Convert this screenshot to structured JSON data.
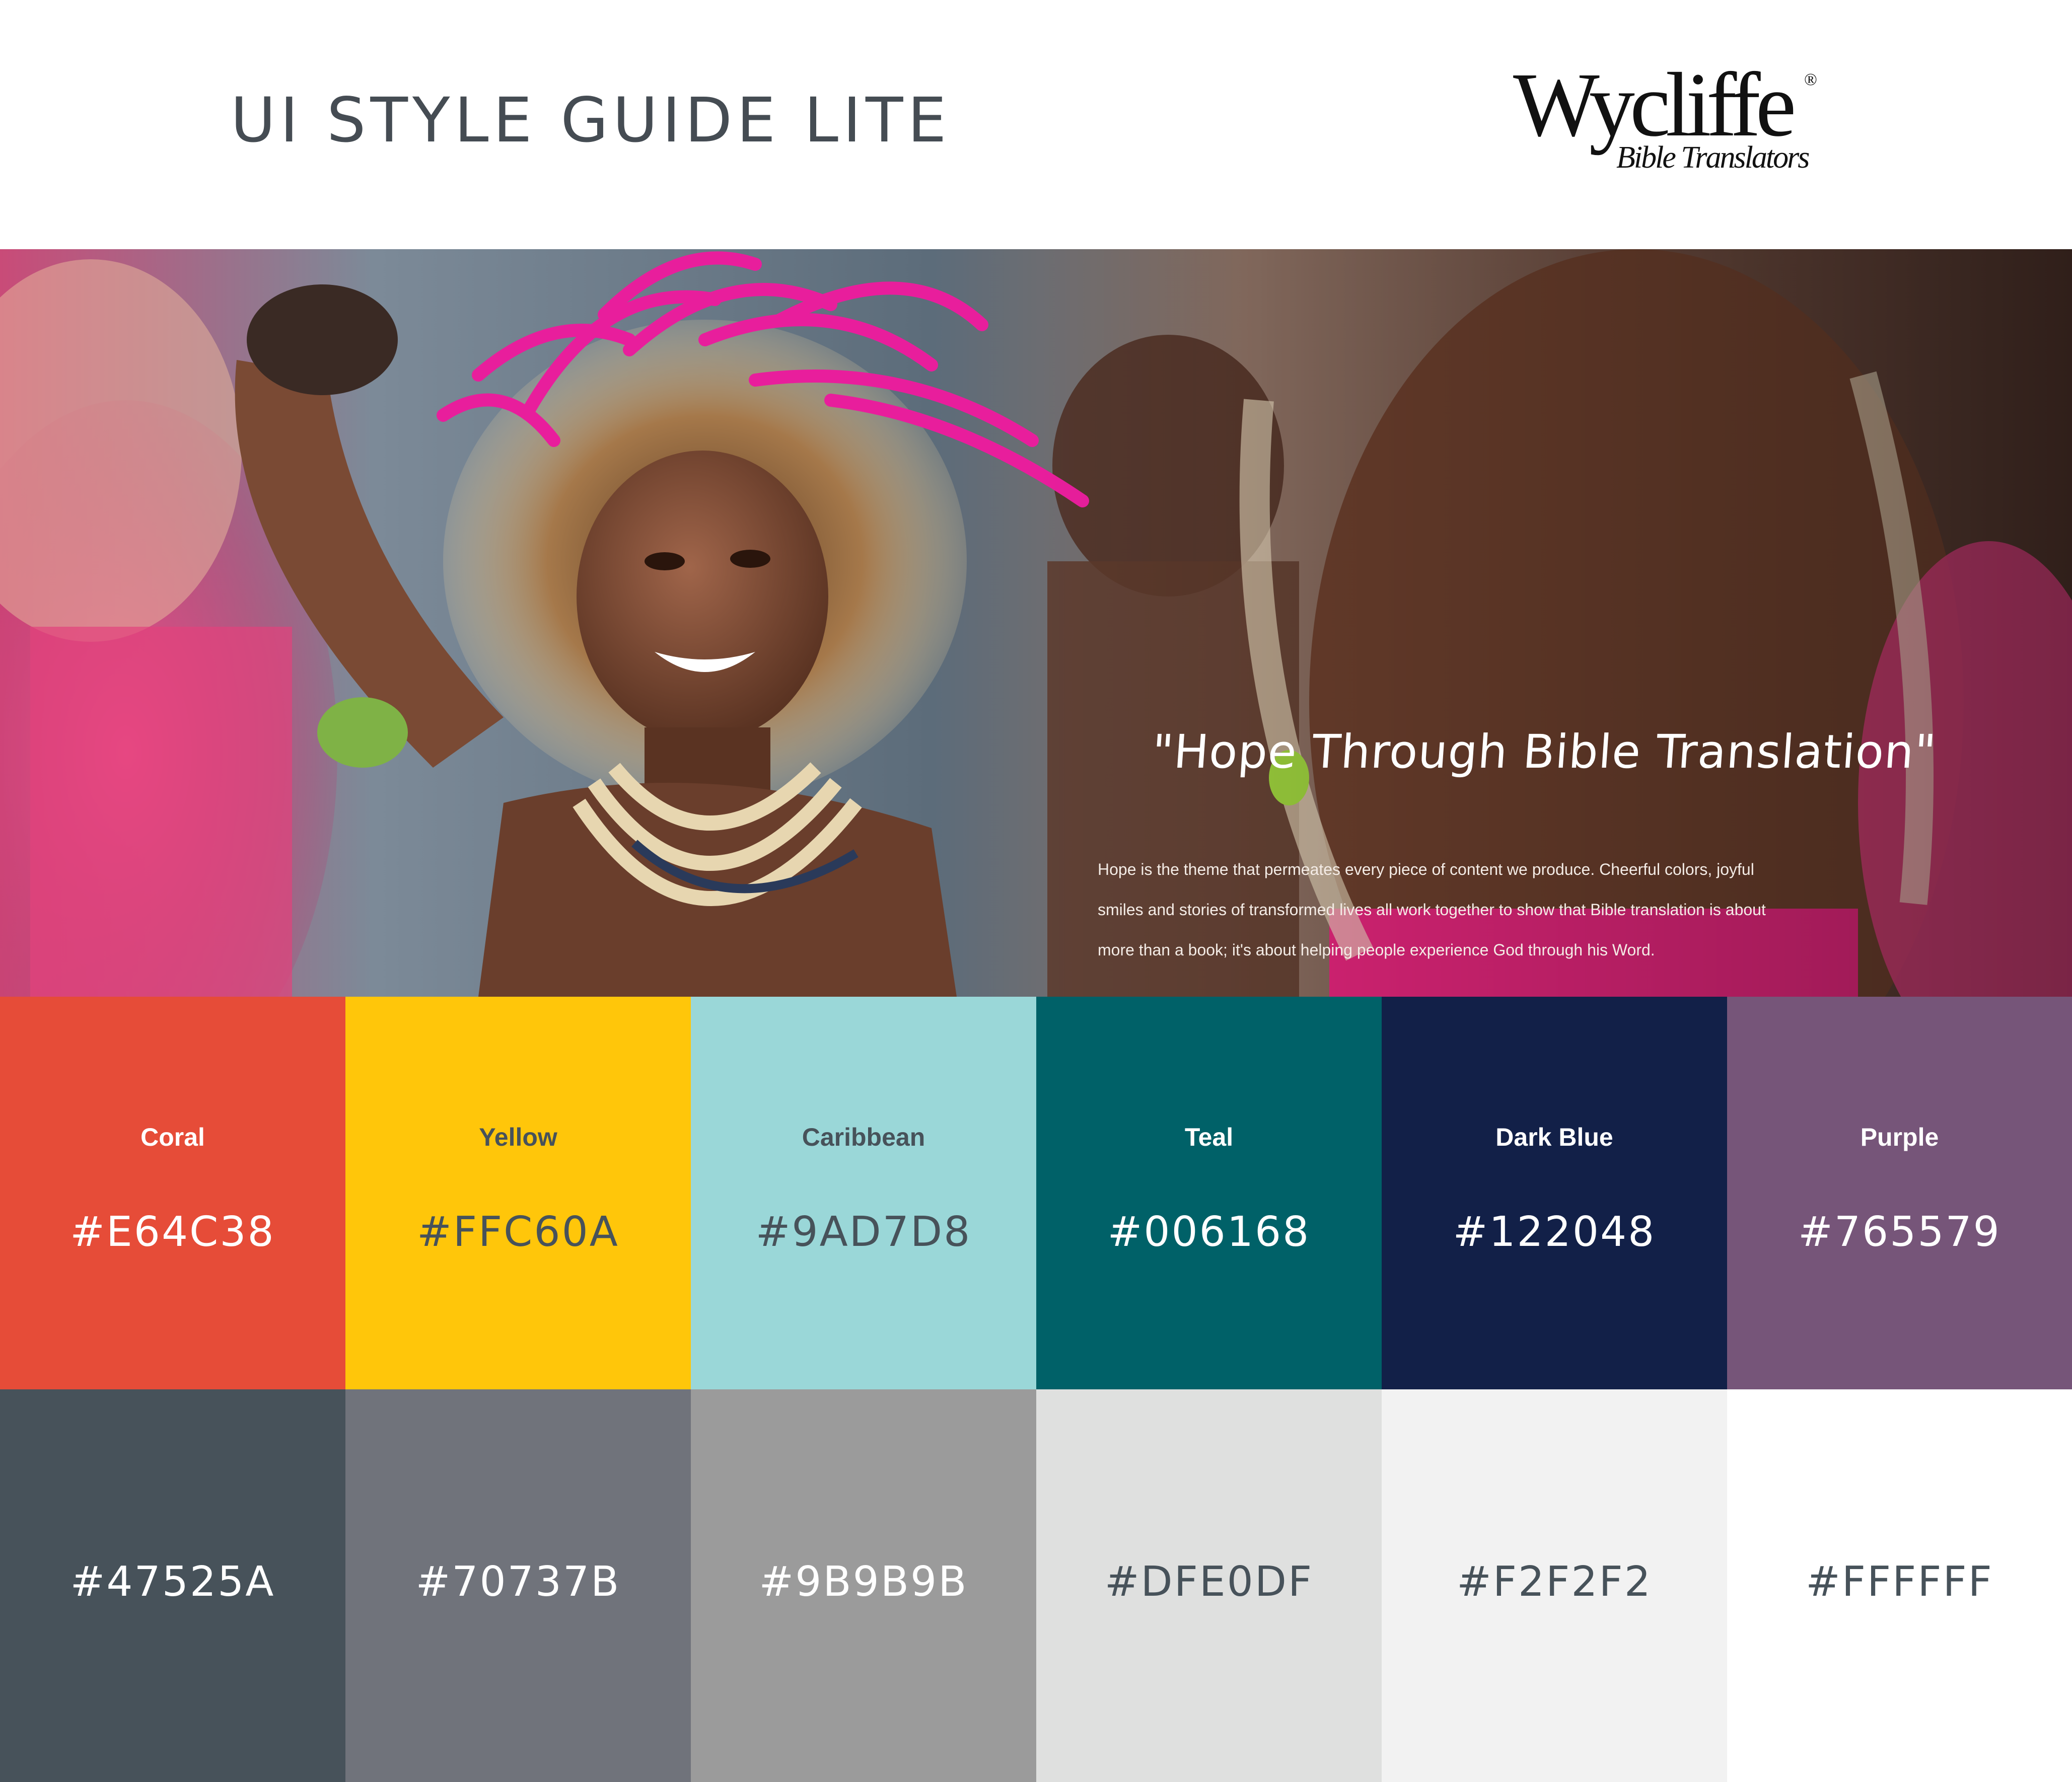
{
  "header": {
    "title": "UI STYLE GUIDE LITE",
    "logo_word": "Wycliffe",
    "logo_mark": "®",
    "logo_sub": "Bible Translators"
  },
  "hero": {
    "quote": "\"Hope Through Bible Translation\"",
    "body": "Hope is the theme that permeates every piece of content we produce. Cheerful colors, joyful smiles and stories of transformed lives all work together to show that Bible translation is about more than a book; it's about helping people experience God through his Word."
  },
  "palette": {
    "primary": [
      {
        "name": "Coral",
        "hex": "#E64C38",
        "bg": "#E64C38",
        "fg": "#ffffff"
      },
      {
        "name": "Yellow",
        "hex": "#FFC60A",
        "bg": "#FFC60A",
        "fg": "#47525A"
      },
      {
        "name": "Caribbean",
        "hex": "#9AD7D8",
        "bg": "#9AD7D8",
        "fg": "#47525A"
      },
      {
        "name": "Teal",
        "hex": "#006168",
        "bg": "#006168",
        "fg": "#ffffff"
      },
      {
        "name": "Dark Blue",
        "hex": "#122048",
        "bg": "#122048",
        "fg": "#ffffff"
      },
      {
        "name": "Purple",
        "hex": "#765579",
        "bg": "#765579",
        "fg": "#ffffff"
      }
    ],
    "neutrals": [
      {
        "hex": "#47525A",
        "bg": "#47525A",
        "fg": "#ffffff"
      },
      {
        "hex": "#70737B",
        "bg": "#70737B",
        "fg": "#ffffff"
      },
      {
        "hex": "#9B9B9B",
        "bg": "#9B9B9B",
        "fg": "#ffffff"
      },
      {
        "hex": "#DFE0DF",
        "bg": "#DFE0DF",
        "fg": "#47525A"
      },
      {
        "hex": "#F2F2F2",
        "bg": "#F2F2F2",
        "fg": "#47525A"
      },
      {
        "hex": "#FFFFFF",
        "bg": "#FFFFFF",
        "fg": "#47525A"
      }
    ]
  }
}
